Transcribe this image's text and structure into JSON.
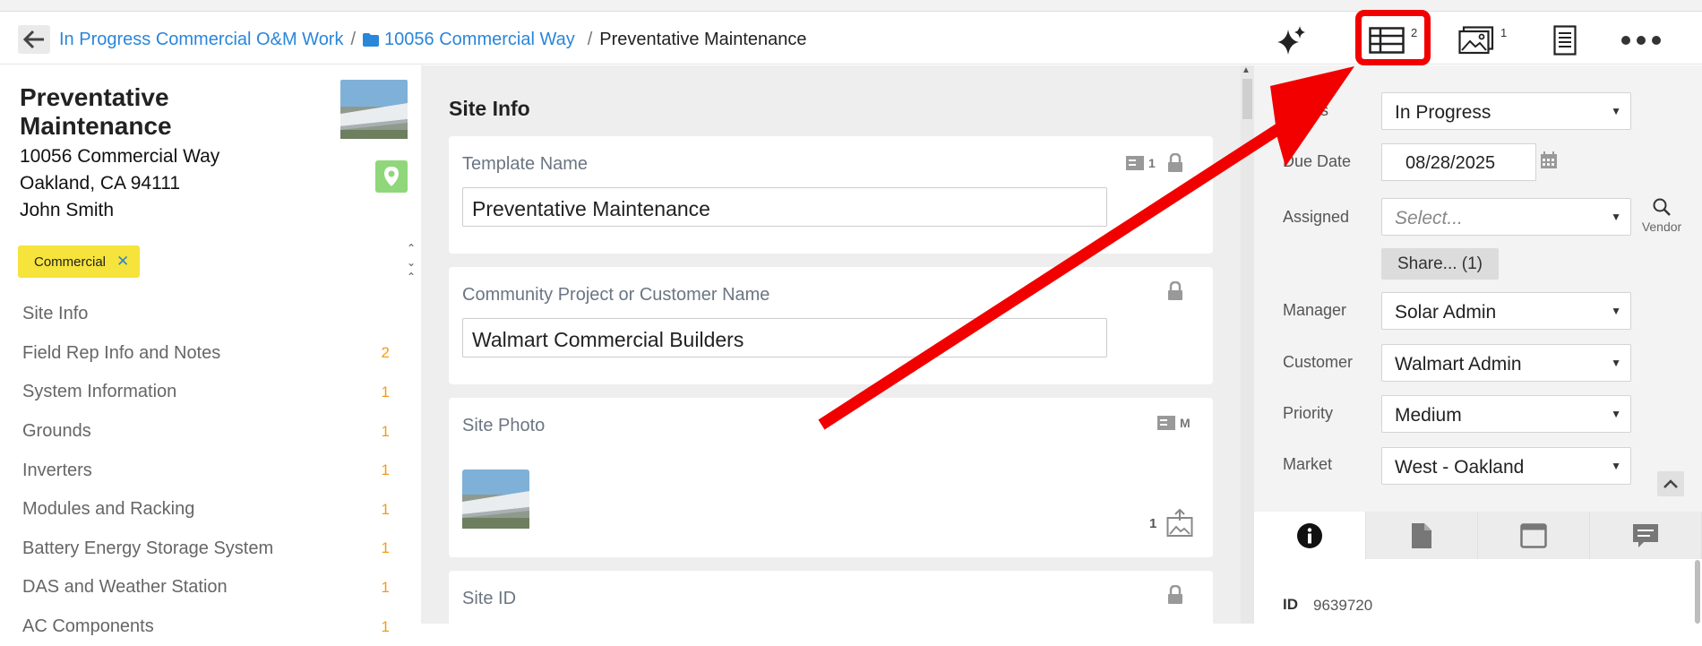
{
  "breadcrumb": {
    "items": [
      "In Progress Commercial O&M Work",
      "10056 Commercial Way"
    ],
    "separator": "/",
    "current": "Preventative Maintenance"
  },
  "toolbar": {
    "sections_count": "2",
    "photos_count": "1"
  },
  "record": {
    "title": "Preventative Maintenance",
    "address_line1": "10056 Commercial Way",
    "address_line2": "Oakland, CA 94111",
    "contact": "John Smith",
    "tag": "Commercial",
    "tag_remove": "✕"
  },
  "sidebar": {
    "items": [
      {
        "label": "Site Info",
        "count": ""
      },
      {
        "label": "Field Rep Info and Notes",
        "count": "2"
      },
      {
        "label": "System Information",
        "count": "1"
      },
      {
        "label": "Grounds",
        "count": "1"
      },
      {
        "label": "Inverters",
        "count": "1"
      },
      {
        "label": "Modules and Racking",
        "count": "1"
      },
      {
        "label": "Battery Energy Storage System",
        "count": "1"
      },
      {
        "label": "DAS and Weather Station",
        "count": "1"
      },
      {
        "label": "AC Components",
        "count": "1"
      }
    ]
  },
  "main": {
    "section_title": "Site Info",
    "template_name_label": "Template Name",
    "template_name_value": "Preventative Maintenance",
    "template_name_badge": "1",
    "customer_label": "Community Project or Customer Name",
    "customer_value": "Walmart Commercial Builders",
    "site_photo_label": "Site Photo",
    "site_photo_badge": "M",
    "site_photo_count": "1",
    "site_id_label": "Site ID"
  },
  "details": {
    "status_label": "Status",
    "status_value": "In Progress",
    "due_date_label": "Due Date",
    "due_date_value": "08/28/2025",
    "assigned_label": "Assigned",
    "assigned_placeholder": "Select...",
    "vendor_label": "Vendor",
    "share_label": "Share... (1)",
    "manager_label": "Manager",
    "manager_value": "Solar Admin",
    "customer_label": "Customer",
    "customer_value": "Walmart Admin",
    "priority_label": "Priority",
    "priority_value": "Medium",
    "market_label": "Market",
    "market_value": "West - Oakland",
    "id_label": "ID",
    "id_value": "9639720"
  },
  "annotation": {
    "color": "#f20000"
  }
}
